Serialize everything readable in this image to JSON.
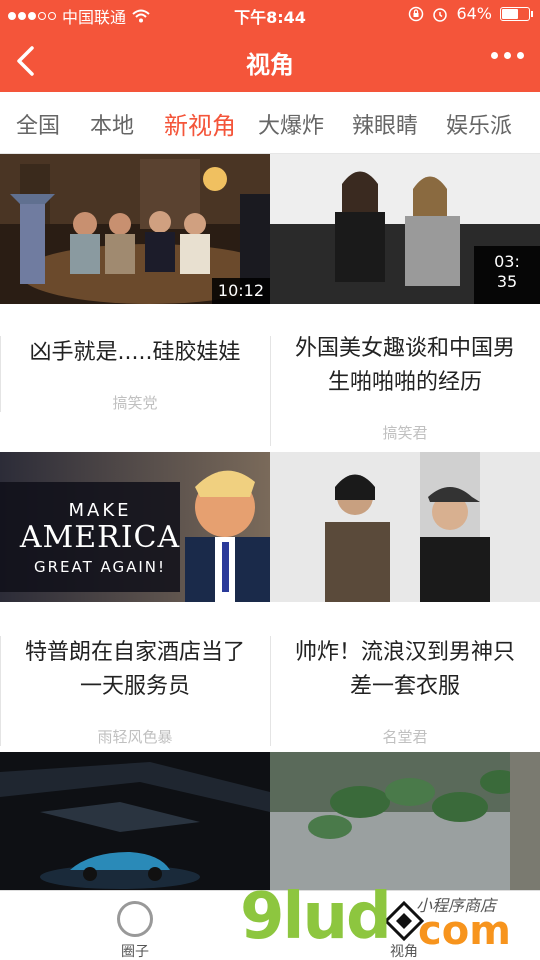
{
  "status_bar": {
    "carrier": "中国联通",
    "time": "下午8:44",
    "battery_percent": "64%",
    "battery_level": 0.64
  },
  "nav": {
    "title": "视角"
  },
  "tabs": [
    {
      "label": "全国",
      "active": false
    },
    {
      "label": "本地",
      "active": false
    },
    {
      "label": "新视角",
      "active": true
    },
    {
      "label": "大爆炸",
      "active": false
    },
    {
      "label": "辣眼睛",
      "active": false
    },
    {
      "label": "娱乐派",
      "active": false
    }
  ],
  "cards": [
    {
      "title": "凶手就是.....硅胶娃娃",
      "source": "搞笑党",
      "duration": "10:12"
    },
    {
      "title": "外国美女趣谈和中国男生啪啪啪的经历",
      "source": "搞笑君",
      "duration": "03:\n35"
    },
    {
      "title": "特普朗在自家酒店当了一天服务员",
      "source": "雨轻风色暴",
      "thumb_text": {
        "line1": "MAKE",
        "line2": "AMERICA",
        "line3": "GREAT AGAIN!"
      }
    },
    {
      "title": "帅炸！流浪汉到男神只差一套衣服",
      "source": "名堂君"
    },
    {
      "title": "",
      "source": ""
    },
    {
      "title": "",
      "source": ""
    }
  ],
  "bottom_tabs": [
    {
      "label": "圈子"
    },
    {
      "label": "视角"
    }
  ],
  "watermark": {
    "brand": "9lud",
    "tld": "com",
    "script": "小程序商店"
  }
}
